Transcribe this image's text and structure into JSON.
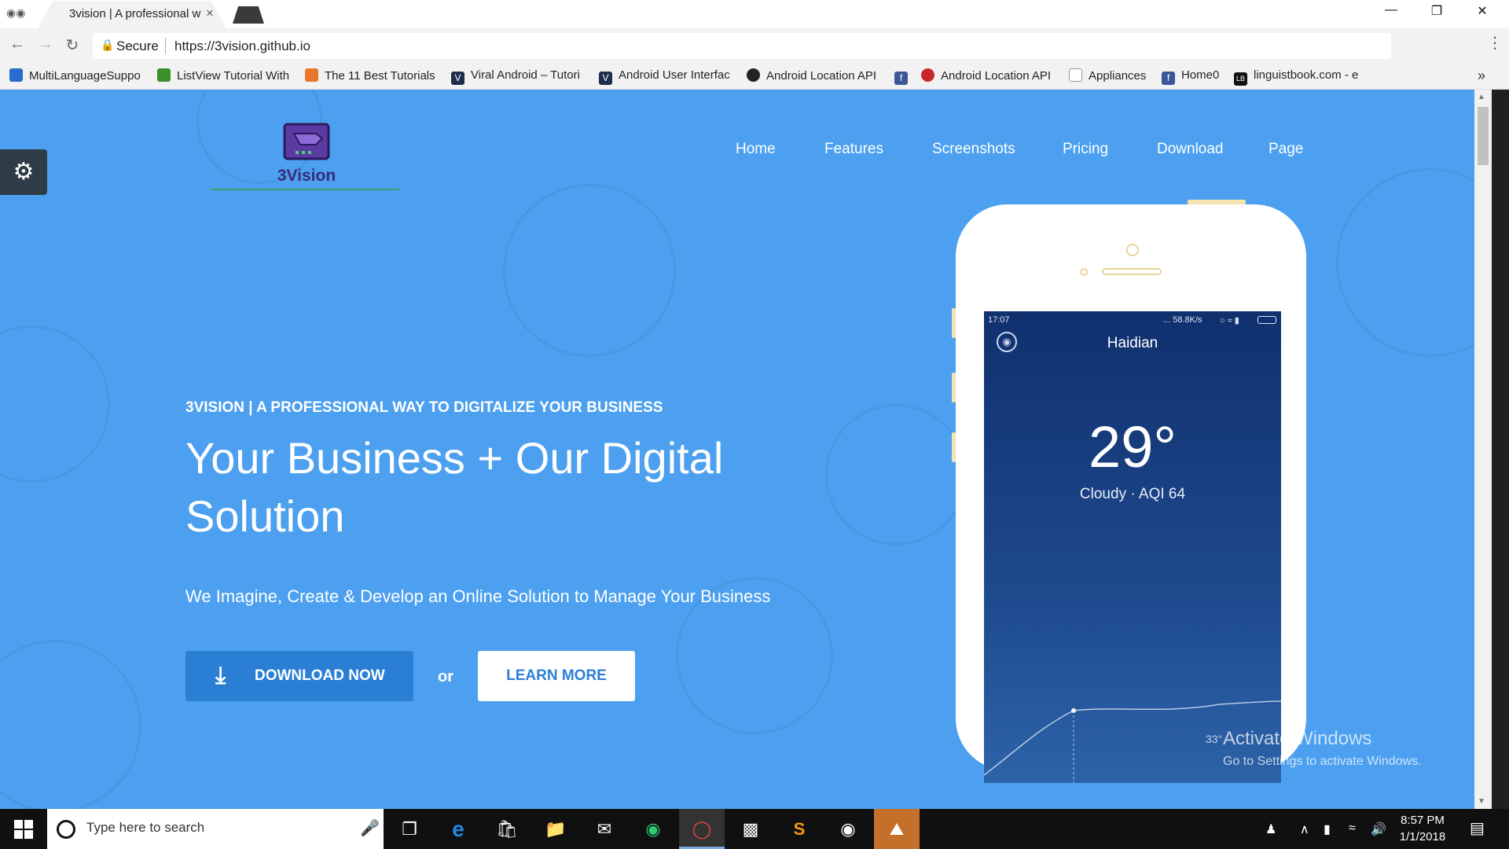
{
  "browser": {
    "tab_title": "3vision | A professional w",
    "tab_close": "×",
    "secure_label": "Secure",
    "url": "https://3vision.github.io",
    "bookmarks": [
      {
        "label": "MultiLanguageSuppo",
        "color": "#2a6bd0"
      },
      {
        "label": "ListView Tutorial With",
        "color": "#3c8f2a"
      },
      {
        "label": "The 11 Best Tutorials",
        "color": "#e8772e"
      },
      {
        "label": "Viral Android – Tutori",
        "color": "#1d2d4c"
      },
      {
        "label": "Android User Interfac",
        "color": "#1d2d4c"
      },
      {
        "label": "Android Location API",
        "color": "#222222"
      },
      {
        "label": "",
        "color": "#3b5998"
      },
      {
        "label": "Android Location API",
        "color": "#c62828"
      },
      {
        "label": "Appliances",
        "color": "#9e9e9e"
      },
      {
        "label": "Home0",
        "color": "#3b5998"
      },
      {
        "label": "linguistbook.com - e",
        "color": "#111111"
      }
    ],
    "bookmarks_more": "»"
  },
  "site": {
    "logo_text": "3Vision",
    "nav": [
      "Home",
      "Features",
      "Screenshots",
      "Pricing",
      "Download",
      "Page"
    ],
    "eyebrow": "3VISION | A PROFESSIONAL WAY TO DIGITALIZE YOUR BUSINESS",
    "headline": "Your Business + Our Digital Solution",
    "subline": "We Imagine, Create & Develop an Online Solution to Manage Your Business",
    "download_label": "DOWNLOAD NOW",
    "or_label": "or",
    "learn_label": "LEARN MORE",
    "accent_color": "#4ca0ef"
  },
  "phone_app": {
    "time": "17:07",
    "net_speed": "... 58.8K/s",
    "city": "Haidian",
    "temperature": "29°",
    "condition": "Cloudy",
    "aqi": "AQI 64",
    "side_temp": "33°"
  },
  "watermark": {
    "title": "Activate Windows",
    "subtitle": "Go to Settings to activate Windows."
  },
  "taskbar": {
    "search_placeholder": "Type here to search",
    "time": "8:57 PM",
    "date": "1/1/2018"
  }
}
